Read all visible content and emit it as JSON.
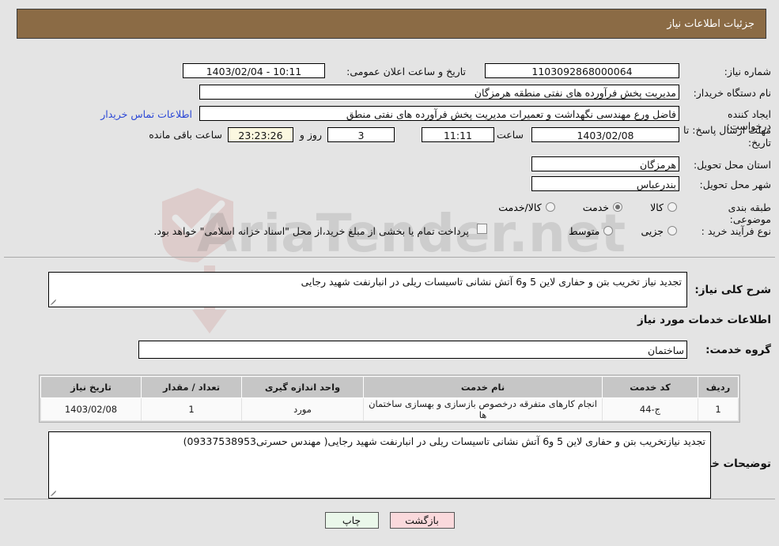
{
  "header": {
    "title": "جزئیات اطلاعات نیاز"
  },
  "colors": {
    "header_bg": "#8b6b45",
    "header_text": "#ffffff",
    "page_bg": "#e4e4e4",
    "link": "#2b47d6",
    "field_bg": "#ffffff",
    "highlight_field_bg": "#fbf8e0",
    "table_header_bg": "#c6c6c6",
    "print_button_bg": "#eaf7ea",
    "back_button_bg": "#fad9dc"
  },
  "top_section": {
    "need_number": {
      "label": "شماره نیاز:",
      "value": "1103092868000064"
    },
    "announce_datetime": {
      "label": "تاریخ و ساعت اعلان عمومی:",
      "value": "10:11 - 1403/02/04"
    },
    "buyer_org": {
      "label": "نام دستگاه خریدار:",
      "value": "مدیریت پخش فرآورده های نفتی منطقه هرمزگان"
    },
    "requester": {
      "label": "ایجاد کننده درخواست:",
      "value": "فاضل ورع مهندسی نگهداشت و تعمیرات مدیریت پخش فرآورده های نفتی منطق",
      "contact_link": "اطلاعات تماس خریدار"
    },
    "deadline": {
      "label": "مهلت ارسال پاسخ: تا تاریخ:",
      "date": "1403/02/08",
      "hour_label": "ساعت",
      "hour": "11:11",
      "days": "3",
      "days_label": "روز و",
      "countdown": "23:23:26",
      "remaining_label": "ساعت باقی مانده"
    },
    "province": {
      "label": "استان محل تحویل:",
      "value": "هرمزگان"
    },
    "city": {
      "label": "شهر محل تحویل:",
      "value": "بندرعباس"
    },
    "category": {
      "label": "طبقه بندی موضوعی:",
      "options": [
        {
          "label": "کالا",
          "selected": false
        },
        {
          "label": "خدمت",
          "selected": true
        },
        {
          "label": "کالا/خدمت",
          "selected": false
        }
      ]
    },
    "process_type": {
      "label": "نوع فرآیند خرید :",
      "options": [
        {
          "label": "جزیی",
          "selected": false
        },
        {
          "label": "متوسط",
          "selected": false
        }
      ],
      "checkbox": {
        "checked": false,
        "label": "پرداخت تمام یا بخشی از مبلغ خرید،از محل \"اسناد خزانه اسلامی\" خواهد بود."
      }
    }
  },
  "mid_section": {
    "general_description": {
      "label": "شرح کلی نیاز:",
      "value": "تجدید نیاز تخریب بتن و حفاری لاین 5 و6 آتش نشانی تاسیسات ریلی در انبارنفت شهید رجایی"
    },
    "services_heading": "اطلاعات خدمات مورد نیاز",
    "service_group": {
      "label": "گروه خدمت:",
      "value": "ساختمان"
    },
    "table": {
      "columns": [
        "ردیف",
        "کد خدمت",
        "نام خدمت",
        "واحد اندازه گیری",
        "تعداد / مقدار",
        "تاریخ نیاز"
      ],
      "rows": [
        [
          "1",
          "ج-44",
          "انجام کارهای متفرقه درخصوص بازسازی و بهسازی ساختمان ها",
          "مورد",
          "1",
          "1403/02/08"
        ]
      ]
    },
    "buyer_notes": {
      "label": "توضیحات خریدار:",
      "value": "تجدید نیازتخریب بتن و حفاری لاین 5 و6 آتش نشانی تاسیسات ریلی در انبارنفت شهید رجایی( مهندس حسرتی09337538953)"
    }
  },
  "footer": {
    "print_button": "چاپ",
    "back_button": "بازگشت"
  },
  "watermark": {
    "text": "AriaTender.net"
  }
}
